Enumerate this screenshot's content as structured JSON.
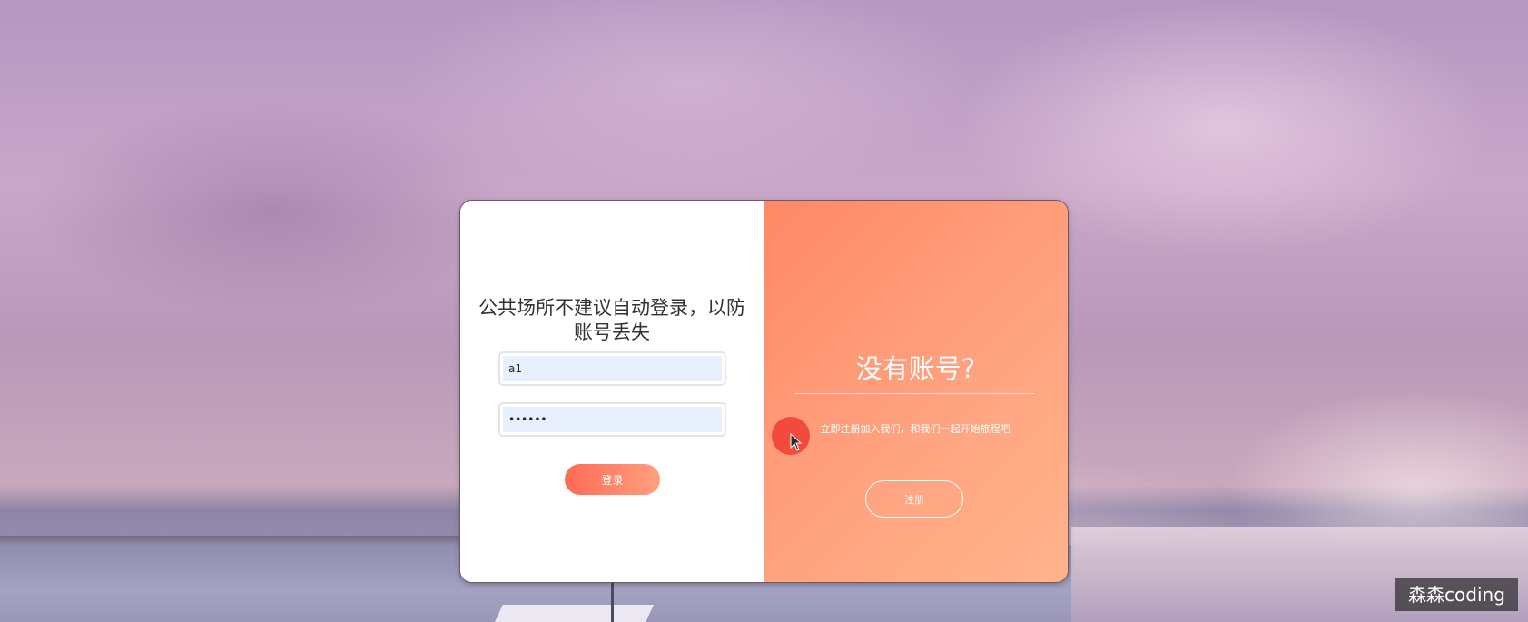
{
  "login": {
    "title": "公共场所不建议自动登录，以防账号丢失",
    "username_value": "a1",
    "password_value": "••••••",
    "login_label": "登录"
  },
  "signup": {
    "title": "没有账号?",
    "description": "立即注册加入我们，和我们一起开始旅程吧",
    "signup_label": "注册"
  },
  "watermark": {
    "text": "森森coding"
  },
  "colors": {
    "accent_start": "#ff6a55",
    "accent_end": "#ffa07e",
    "panel_gradient_start": "#ff8866",
    "panel_gradient_end": "#ffb48c"
  },
  "icons": {
    "cursor": "mouse-pointer-icon"
  }
}
